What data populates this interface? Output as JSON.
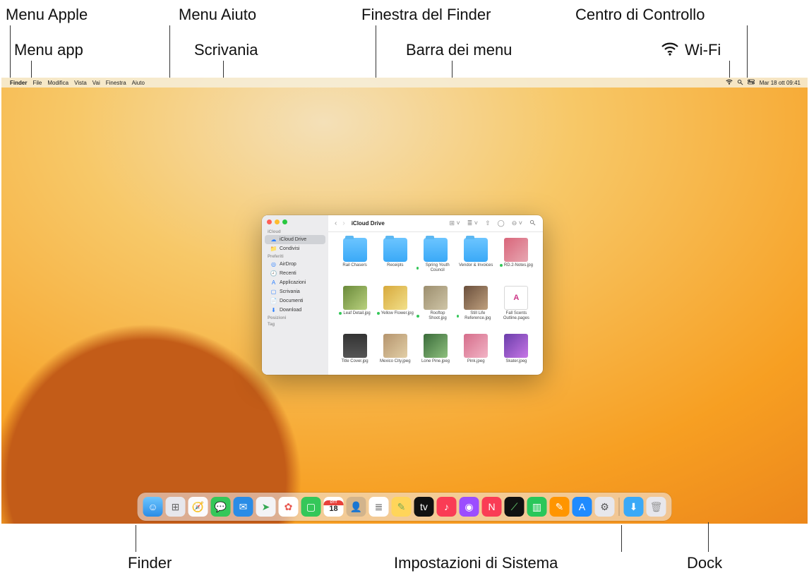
{
  "callouts": {
    "menu_apple": "Menu Apple",
    "menu_app": "Menu app",
    "menu_aiuto": "Menu Aiuto",
    "scrivania": "Scrivania",
    "finestra_finder": "Finestra del Finder",
    "barra_menu": "Barra dei menu",
    "centro_controllo": "Centro di Controllo",
    "wifi": "Wi-Fi",
    "finder": "Finder",
    "impostazioni": "Impostazioni di Sistema",
    "dock": "Dock"
  },
  "menubar": {
    "app": "Finder",
    "items": [
      "File",
      "Modifica",
      "Vista",
      "Vai",
      "Finestra",
      "Aiuto"
    ],
    "datetime": "Mar 18 ott  09:41"
  },
  "finder": {
    "title": "iCloud Drive",
    "sidebar": {
      "sections": [
        {
          "header": "iCloud",
          "items": [
            {
              "label": "iCloud Drive",
              "icon": "☁︎",
              "selected": true
            },
            {
              "label": "Condivisi",
              "icon": "📁"
            }
          ]
        },
        {
          "header": "Preferiti",
          "items": [
            {
              "label": "AirDrop",
              "icon": "◎"
            },
            {
              "label": "Recenti",
              "icon": "🕘"
            },
            {
              "label": "Applicazioni",
              "icon": "A"
            },
            {
              "label": "Scrivania",
              "icon": "▢"
            },
            {
              "label": "Documenti",
              "icon": "📄"
            },
            {
              "label": "Download",
              "icon": "⬇︎"
            }
          ]
        },
        {
          "header": "Posizioni",
          "items": []
        },
        {
          "header": "Tag",
          "items": []
        }
      ]
    },
    "items": [
      {
        "label": "Rail Chasers",
        "type": "folder",
        "tag": false
      },
      {
        "label": "Receipts",
        "type": "folder",
        "tag": false
      },
      {
        "label": "Spring Youth Council",
        "type": "folder",
        "tag": true
      },
      {
        "label": "Vendor & Invoices",
        "type": "folder",
        "tag": false
      },
      {
        "label": "RD.2-Notes.jpg",
        "type": "img1",
        "tag": true
      },
      {
        "label": "Leaf Detail.jpg",
        "type": "img2",
        "tag": true
      },
      {
        "label": "Yellow Flower.jpg",
        "type": "img3",
        "tag": true
      },
      {
        "label": "Rooftop Shoot.jpg",
        "type": "img4",
        "tag": true
      },
      {
        "label": "Still Life Reference.jpg",
        "type": "img5",
        "tag": true
      },
      {
        "label": "Fall Scents Outline.pages",
        "type": "doc",
        "tag": false
      },
      {
        "label": "Title Cover.jpg",
        "type": "img6",
        "tag": false
      },
      {
        "label": "Mexico City.jpeg",
        "type": "img7",
        "tag": false
      },
      {
        "label": "Lone Pine.jpeg",
        "type": "img8",
        "tag": false
      },
      {
        "label": "Pink.jpeg",
        "type": "img9",
        "tag": false
      },
      {
        "label": "Skater.jpeg",
        "type": "img10",
        "tag": false
      }
    ]
  },
  "dock": {
    "calendar": {
      "month": "OTT",
      "day": "18"
    },
    "items": [
      {
        "name": "finder",
        "glyph": "☺"
      },
      {
        "name": "launchpad",
        "glyph": "⊞"
      },
      {
        "name": "safari",
        "glyph": "🧭"
      },
      {
        "name": "messages",
        "glyph": "💬"
      },
      {
        "name": "mail",
        "glyph": "✉︎"
      },
      {
        "name": "maps",
        "glyph": "➤"
      },
      {
        "name": "photos",
        "glyph": "✿"
      },
      {
        "name": "facetime",
        "glyph": "▢"
      },
      {
        "name": "calendar",
        "glyph": ""
      },
      {
        "name": "contacts",
        "glyph": "👤"
      },
      {
        "name": "reminders",
        "glyph": "≣"
      },
      {
        "name": "notes",
        "glyph": "✎"
      },
      {
        "name": "tv",
        "glyph": "tv"
      },
      {
        "name": "music",
        "glyph": "♪"
      },
      {
        "name": "podcasts",
        "glyph": "◉"
      },
      {
        "name": "news",
        "glyph": "N"
      },
      {
        "name": "stocks",
        "glyph": "⟋"
      },
      {
        "name": "numbers",
        "glyph": "▥"
      },
      {
        "name": "pages",
        "glyph": "✎"
      },
      {
        "name": "appstore",
        "glyph": "A"
      },
      {
        "name": "settings",
        "glyph": "⚙︎"
      }
    ],
    "right_items": [
      {
        "name": "downloads",
        "glyph": "⬇︎"
      },
      {
        "name": "trash",
        "glyph": "🗑"
      }
    ]
  }
}
